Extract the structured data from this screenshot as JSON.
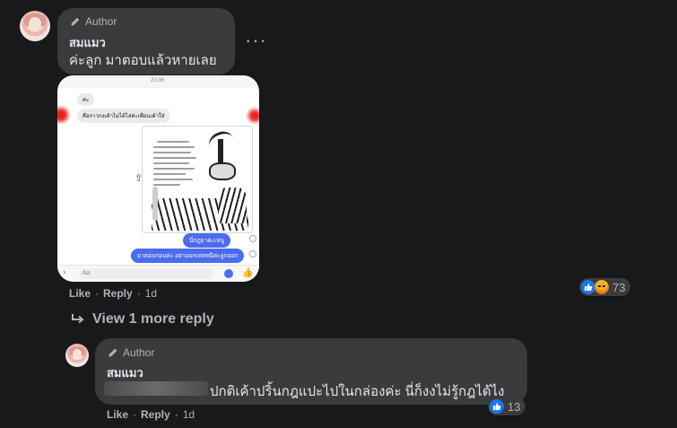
{
  "comment": {
    "badge": "Author",
    "name": "สมแมว",
    "text": "ค่ะลูก มาตอบแล้วหายเลย",
    "actions": {
      "like": "Like",
      "reply": "Reply",
      "time": "1d"
    },
    "reactions": {
      "count": "73",
      "icons": [
        "like-icon",
        "angry-icon"
      ]
    },
    "image": {
      "time": "20:36",
      "chat_msg_1": "ค่ะ",
      "chat_msg_2": "คือกาวกงเค้าไม่ได้ไส่ค่ะเพื่อนเค้าใส่",
      "chat_reply_1": "นี่กฎยาค่ะเหนู",
      "chat_reply_2": "มาตอบก่อนค่ะ อย่าออกเฟสหนีค่ะลูกออก",
      "input_placeholder": "Aa"
    }
  },
  "view_more": "View 1 more reply",
  "reply": {
    "badge": "Author",
    "name": "สมแมว",
    "text": "ปกติเค้าปริ้นกฎแปะไปในกล่องค่ะ นี่ก็งงไม่รู้กฎได้ไง",
    "actions": {
      "like": "Like",
      "reply": "Reply",
      "time": "1d"
    },
    "reactions": {
      "count": "13",
      "icons": [
        "like-icon"
      ]
    }
  },
  "colors": {
    "background": "#18191a",
    "bubble": "#3a3b3c",
    "accent": "#1877f2",
    "text": "#e4e6eb",
    "muted": "#b0b3b8"
  }
}
